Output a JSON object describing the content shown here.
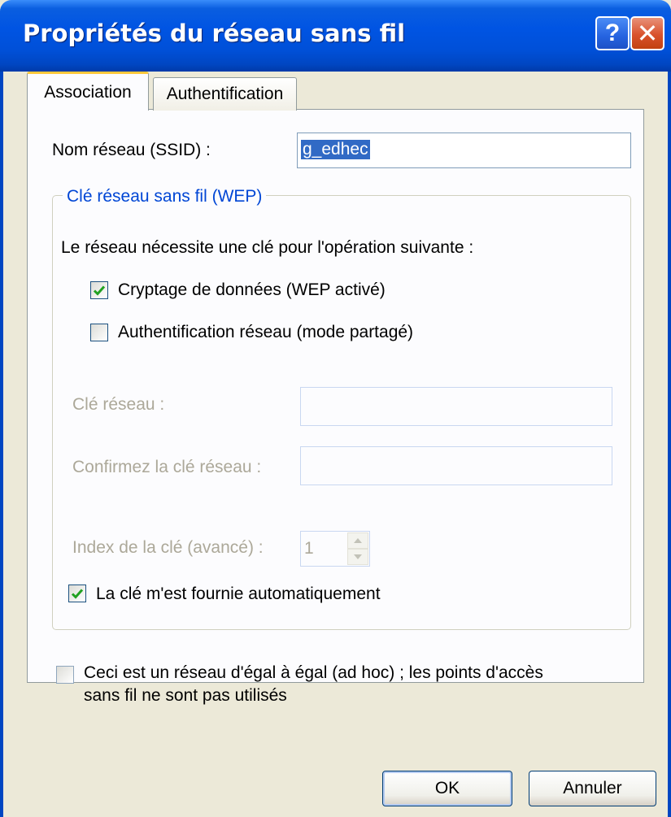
{
  "window": {
    "title": "Propriétés du réseau sans fil",
    "help_label": "?",
    "close_label": "✕"
  },
  "tabs": [
    {
      "label": "Association",
      "selected": true
    },
    {
      "label": "Authentification",
      "selected": false
    }
  ],
  "ssid": {
    "label": "Nom réseau (SSID) :",
    "value": "g_edhec"
  },
  "wep_group": {
    "legend": "Clé réseau sans fil (WEP)",
    "requirement_text": "Le réseau nécessite une clé pour l'opération suivante :",
    "data_encryption": {
      "label": "Cryptage de données (WEP activé)",
      "checked": true
    },
    "network_auth": {
      "label": "Authentification réseau (mode partagé)",
      "checked": false
    },
    "network_key": {
      "label": "Clé réseau :",
      "value": ""
    },
    "confirm_key": {
      "label": "Confirmez la clé réseau :",
      "value": ""
    },
    "key_index": {
      "label": "Index de la clé (avancé) :",
      "value": "1"
    },
    "auto_key": {
      "label": "La clé m'est fournie automatiquement",
      "checked": true
    }
  },
  "adhoc": {
    "line1": "Ceci est un réseau d'égal à égal (ad hoc) ; les points d'accès",
    "line2": "sans fil ne sont pas utilisés",
    "checked": false
  },
  "buttons": {
    "ok": "OK",
    "cancel": "Annuler"
  },
  "colors": {
    "title_bar": "#0054e3",
    "dialog_background": "#ece9d8",
    "group_legend": "#0046d5",
    "check_mark": "#21a121",
    "selected_text_bg": "#316ac5",
    "disabled_text": "#aca899"
  },
  "icons": {
    "help": "help-icon",
    "close": "close-icon",
    "check": "checkmark-icon",
    "spin_up": "arrow-up-icon",
    "spin_down": "arrow-down-icon"
  }
}
